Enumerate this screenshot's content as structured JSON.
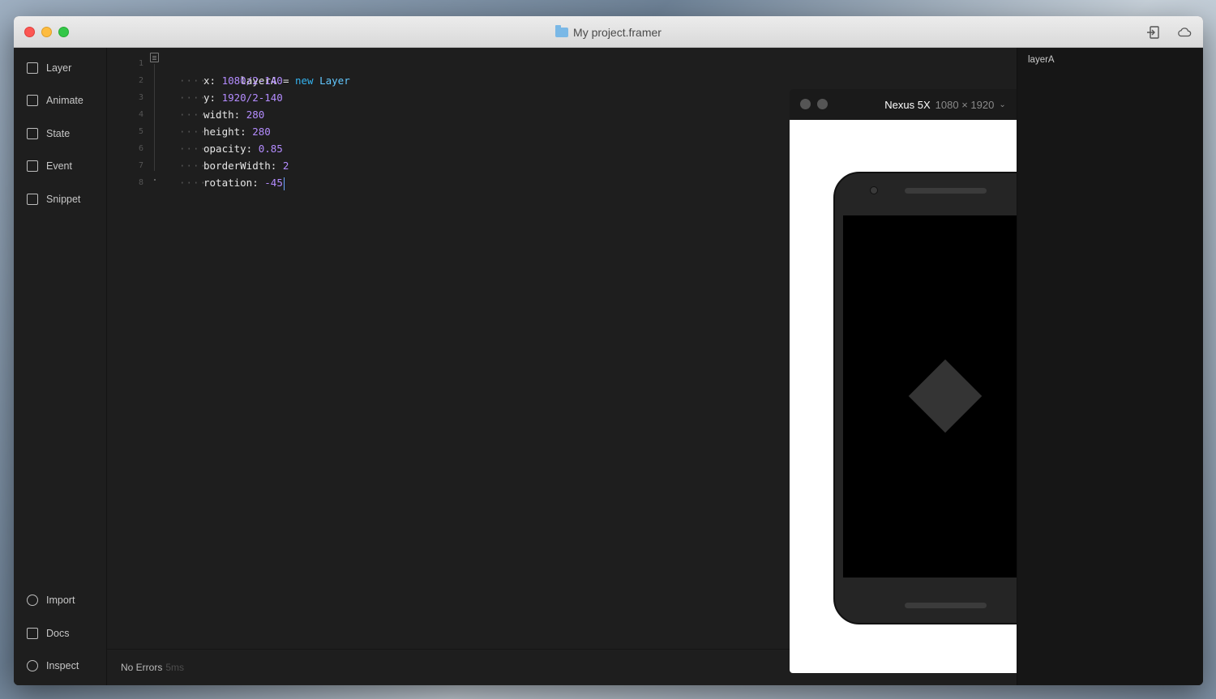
{
  "window": {
    "title": "My project.framer"
  },
  "sidebar": {
    "top_items": [
      {
        "label": "Layer",
        "icon": "layer-plus-icon"
      },
      {
        "label": "Animate",
        "icon": "animate-icon"
      },
      {
        "label": "State",
        "icon": "state-grid-icon"
      },
      {
        "label": "Event",
        "icon": "event-icon"
      },
      {
        "label": "Snippet",
        "icon": "snippet-icon"
      }
    ],
    "bottom_items": [
      {
        "label": "Import",
        "icon": "import-icon"
      },
      {
        "label": "Docs",
        "icon": "docs-icon"
      },
      {
        "label": "Inspect",
        "icon": "inspect-icon"
      }
    ]
  },
  "editor": {
    "lines": [
      {
        "number": "1",
        "var": "layerA",
        "op": " = ",
        "kw": "new",
        "cls": "Layer"
      },
      {
        "number": "2",
        "key": "x: ",
        "value": "1080/2-140"
      },
      {
        "number": "3",
        "key": "y: ",
        "value": "1920/2-140"
      },
      {
        "number": "4",
        "key": "width: ",
        "value": "280"
      },
      {
        "number": "5",
        "key": "height: ",
        "value": "280"
      },
      {
        "number": "6",
        "key": "opacity: ",
        "value": "0.85"
      },
      {
        "number": "7",
        "key": "borderWidth: ",
        "value": "2"
      },
      {
        "number": "8",
        "key": "rotation: ",
        "value": "-45"
      }
    ],
    "status": {
      "text": "No Errors",
      "time": "5ms"
    }
  },
  "preview": {
    "device_name": "Nexus 5X",
    "device_size": "1080 × 1920"
  },
  "layers_panel": {
    "items": [
      "layerA"
    ]
  },
  "colors": {
    "keyword": "#34b3f0",
    "number": "#b48cff",
    "background": "#1e1e1e"
  }
}
